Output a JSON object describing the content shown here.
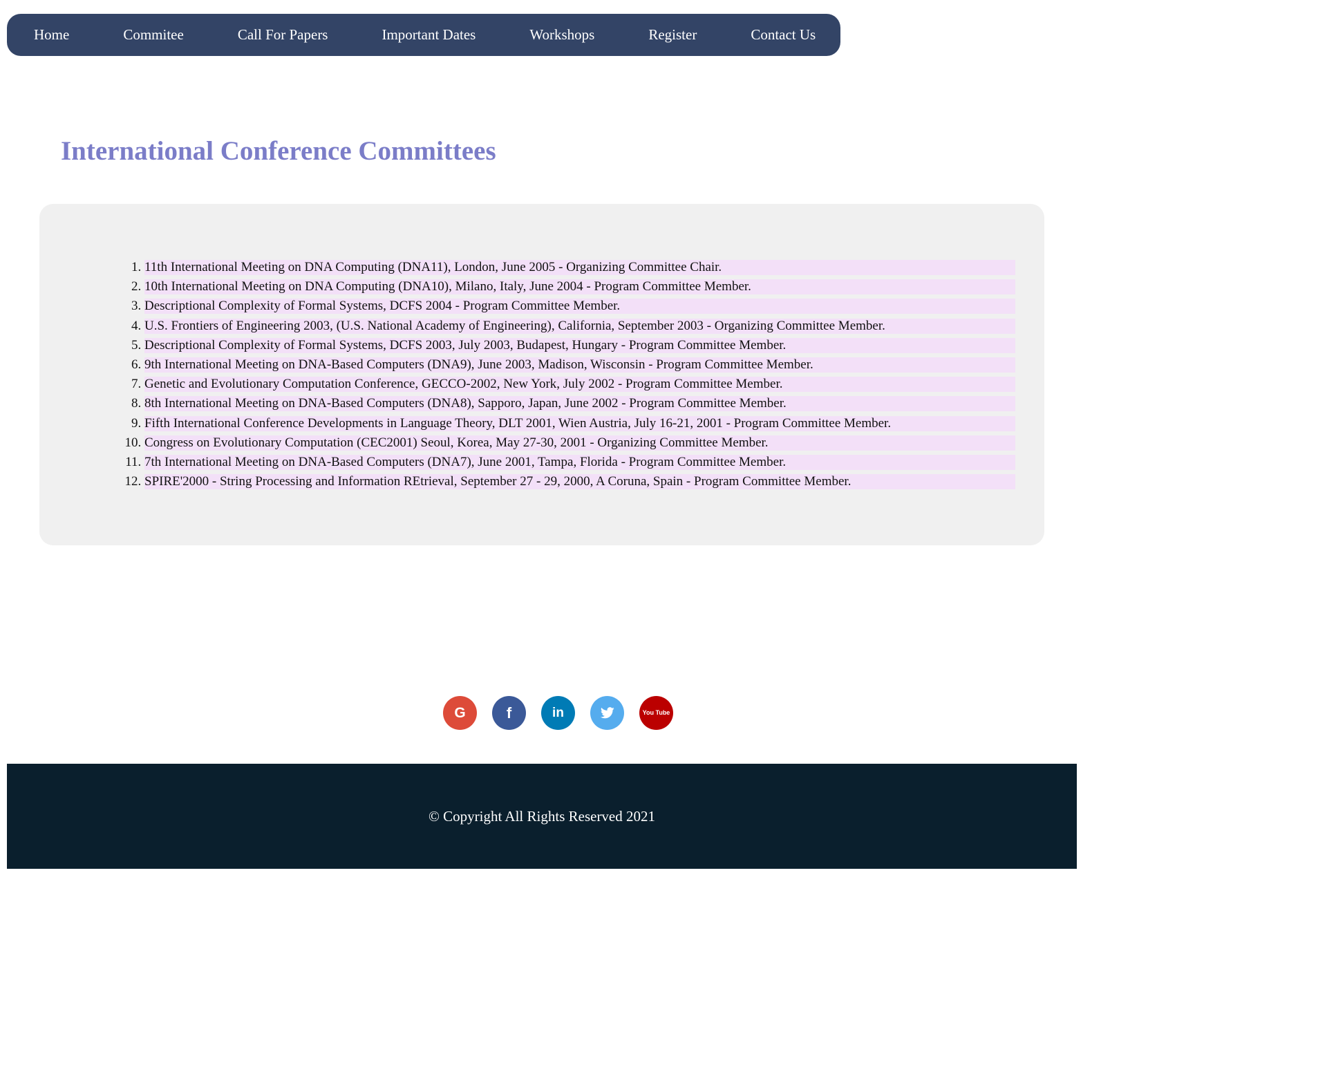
{
  "nav": {
    "items": [
      {
        "label": "Home"
      },
      {
        "label": "Commitee"
      },
      {
        "label": "Call For Papers"
      },
      {
        "label": "Important Dates"
      },
      {
        "label": "Workshops"
      },
      {
        "label": "Register"
      },
      {
        "label": "Contact Us"
      }
    ]
  },
  "page": {
    "title": "International Conference Committees"
  },
  "committees": [
    "11th International Meeting on DNA Computing (DNA11), London, June 2005 - Organizing Committee Chair.",
    "10th International Meeting on DNA Computing (DNA10), Milano, Italy, June 2004 - Program Committee Member.",
    "Descriptional Complexity of Formal Systems, DCFS 2004 - Program Committee Member.",
    "U.S. Frontiers of Engineering 2003, (U.S. National Academy of Engineering), California, September 2003 - Organizing Committee Member.",
    "Descriptional Complexity of Formal Systems, DCFS 2003, July 2003, Budapest, Hungary - Program Committee Member.",
    "9th International Meeting on DNA-Based Computers (DNA9), June 2003, Madison, Wisconsin - Program Committee Member.",
    "Genetic and Evolutionary Computation Conference, GECCO-2002, New York, July 2002 - Program Committee Member.",
    "8th International Meeting on DNA-Based Computers (DNA8), Sapporo, Japan, June 2002 - Program Committee Member.",
    "Fifth International Conference Developments in Language Theory, DLT 2001, Wien Austria, July 16-21, 2001 - Program Committee Member.",
    "Congress on Evolutionary Computation (CEC2001) Seoul, Korea, May 27-30, 2001 - Organizing Committee Member.",
    "7th International Meeting on DNA-Based Computers (DNA7), June 2001, Tampa, Florida - Program Committee Member.",
    "SPIRE'2000 - String Processing and Information REtrieval, September 27 - 29, 2000, A Coruna, Spain - Program Committee Member."
  ],
  "social": [
    {
      "icon": "google-icon",
      "glyph": "G",
      "color": "#dd4b39"
    },
    {
      "icon": "facebook-icon",
      "glyph": "f",
      "color": "#3b5998"
    },
    {
      "icon": "linkedin-icon",
      "glyph": "in",
      "color": "#007bb5"
    },
    {
      "icon": "twitter-icon",
      "glyph": "",
      "color": "#55acee"
    },
    {
      "icon": "youtube-icon",
      "glyph": "You Tube",
      "color": "#bb0000"
    }
  ],
  "footer": {
    "copyright": "© Copyright All Rights Reserved 2021"
  },
  "colors": {
    "nav_bg": "#334466",
    "title": "#7b7dc8",
    "content_bg": "#f0f0f0",
    "item_highlight": "#f3e0f8",
    "footer_bg": "#0a1f2d"
  }
}
